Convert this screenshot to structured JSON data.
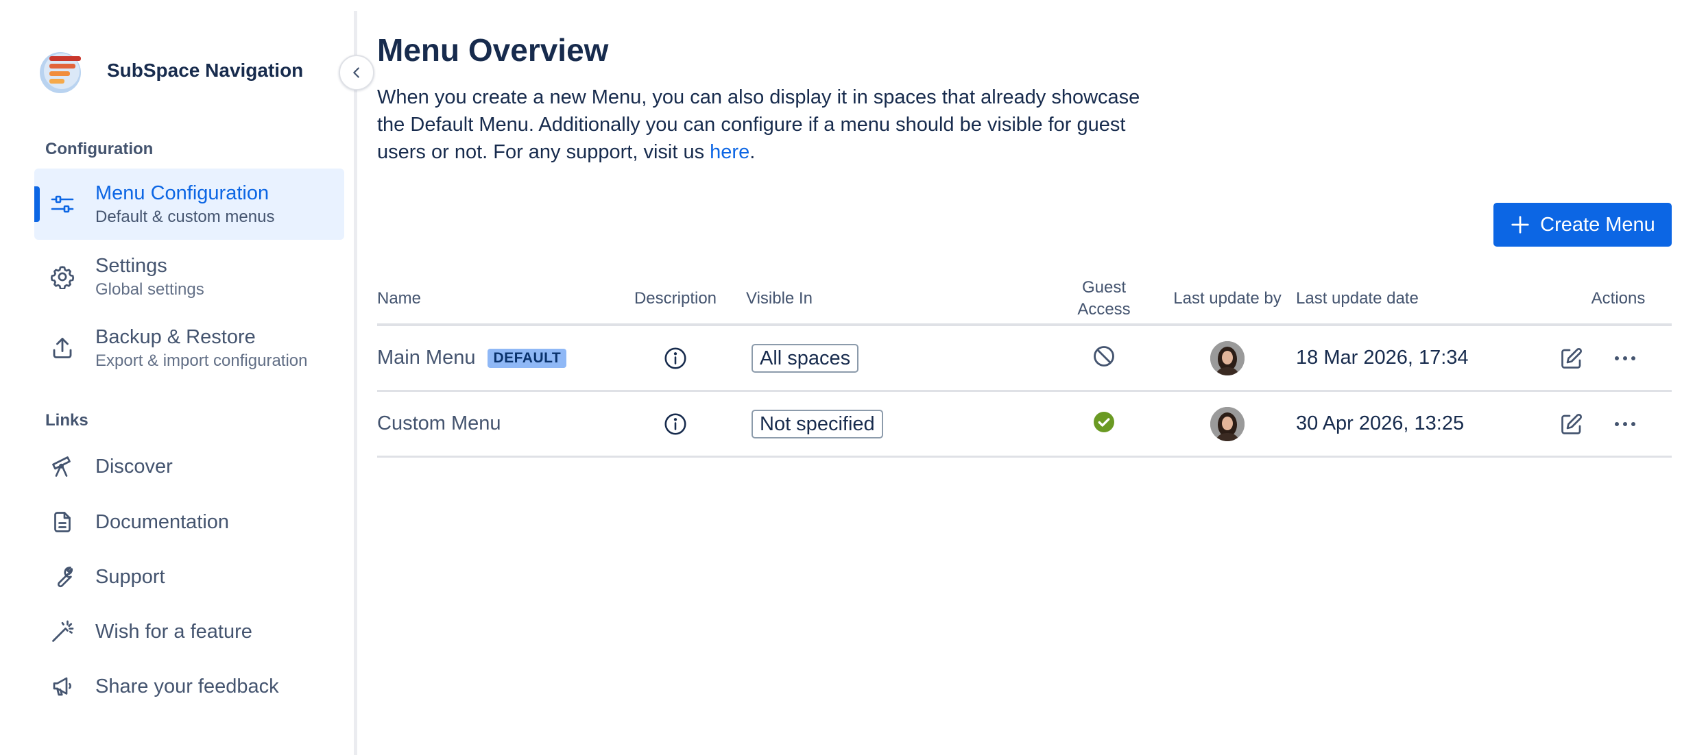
{
  "brand": {
    "name": "SubSpace Navigation",
    "logo_icon": "subspace-logo-icon"
  },
  "sidebar": {
    "configuration_label": "Configuration",
    "config_items": [
      {
        "title": "Menu Configuration",
        "subtitle": "Default & custom menus",
        "icon": "sliders-icon",
        "active": true
      },
      {
        "title": "Settings",
        "subtitle": "Global settings",
        "icon": "gear-icon",
        "active": false
      },
      {
        "title": "Backup & Restore",
        "subtitle": "Export & import configuration",
        "icon": "upload-icon",
        "active": false
      }
    ],
    "links_label": "Links",
    "link_items": [
      {
        "title": "Discover",
        "icon": "telescope-icon"
      },
      {
        "title": "Documentation",
        "icon": "document-icon"
      },
      {
        "title": "Support",
        "icon": "wrench-icon"
      },
      {
        "title": "Wish for a feature",
        "icon": "magic-wand-icon"
      },
      {
        "title": "Share your feedback",
        "icon": "megaphone-icon"
      }
    ]
  },
  "main": {
    "title": "Menu Overview",
    "description": "When you create a new Menu, you can also display it in spaces that already showcase the Default Menu. Additionally you can configure if a menu should be visible for guest users or not. For any support, visit us ",
    "description_link": "here",
    "description_end": ".",
    "create_button_label": "Create Menu",
    "table": {
      "headers": {
        "name": "Name",
        "description": "Description",
        "visible_in": "Visible In",
        "guest_access": "Guest Access",
        "last_update_by": "Last update by",
        "last_update_date": "Last update date",
        "actions": "Actions"
      },
      "rows": [
        {
          "name": "Main Menu",
          "badge": "DEFAULT",
          "visible_in": "All spaces",
          "guest_access": "disabled",
          "last_update_date": "18 Mar 2026, 17:34"
        },
        {
          "name": "Custom Menu",
          "badge": "",
          "visible_in": "Not specified",
          "guest_access": "enabled",
          "last_update_date": "30 Apr 2026, 13:25"
        }
      ]
    }
  },
  "colors": {
    "accent": "#0c66e4",
    "active_bg": "#e9f2ff",
    "badge_bg": "#8fb8f6",
    "success": "#6a9a23",
    "text": "#172b4d",
    "subtle_text": "#44546f"
  }
}
